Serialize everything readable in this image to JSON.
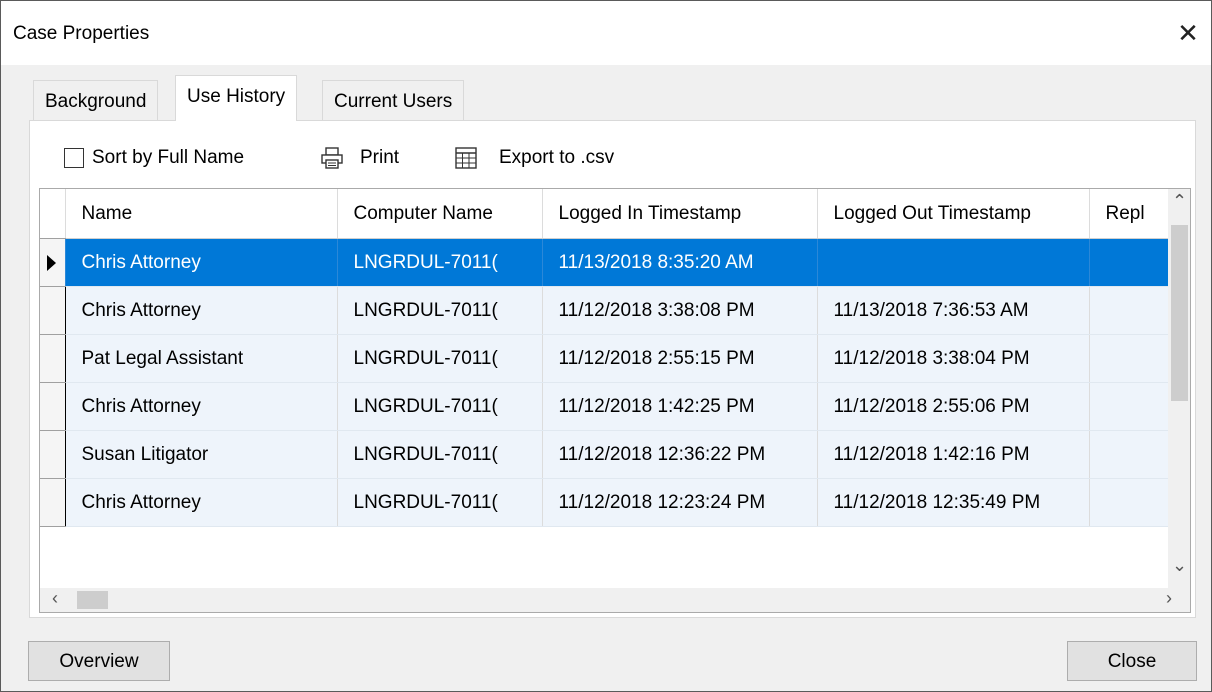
{
  "window": {
    "title": "Case Properties",
    "close_glyph": "✕"
  },
  "tabs": [
    {
      "label": "Background"
    },
    {
      "label": "Use History"
    },
    {
      "label": "Current Users"
    }
  ],
  "toolbar": {
    "sort_label": "Sort by Full Name",
    "sort_checked": false,
    "print_label": "Print",
    "export_label": "Export to .csv"
  },
  "table": {
    "columns": [
      "Name",
      "Computer Name",
      "Logged In Timestamp",
      "Logged Out Timestamp",
      "Repl"
    ],
    "rows": [
      {
        "name": "Chris Attorney",
        "computer": "LNGRDUL-7011(",
        "in": "11/13/2018 8:35:20 AM",
        "out": "",
        "repl": "",
        "selected": true
      },
      {
        "name": "Chris Attorney",
        "computer": "LNGRDUL-7011(",
        "in": "11/12/2018 3:38:08 PM",
        "out": "11/13/2018 7:36:53 AM",
        "repl": ""
      },
      {
        "name": "Pat Legal Assistant",
        "computer": "LNGRDUL-7011(",
        "in": "11/12/2018 2:55:15 PM",
        "out": "11/12/2018 3:38:04 PM",
        "repl": ""
      },
      {
        "name": "Chris Attorney",
        "computer": "LNGRDUL-7011(",
        "in": "11/12/2018 1:42:25 PM",
        "out": "11/12/2018 2:55:06 PM",
        "repl": ""
      },
      {
        "name": "Susan Litigator",
        "computer": "LNGRDUL-7011(",
        "in": "11/12/2018 12:36:22 PM",
        "out": "11/12/2018 1:42:16 PM",
        "repl": ""
      },
      {
        "name": "Chris Attorney",
        "computer": "LNGRDUL-7011(",
        "in": "11/12/2018 12:23:24 PM",
        "out": "11/12/2018 12:35:49 PM",
        "repl": ""
      }
    ]
  },
  "buttons": {
    "overview_label": "Overview",
    "close_label": "Close"
  },
  "colors": {
    "selection": "#0078d7",
    "row_bg": "#eef4fb"
  }
}
